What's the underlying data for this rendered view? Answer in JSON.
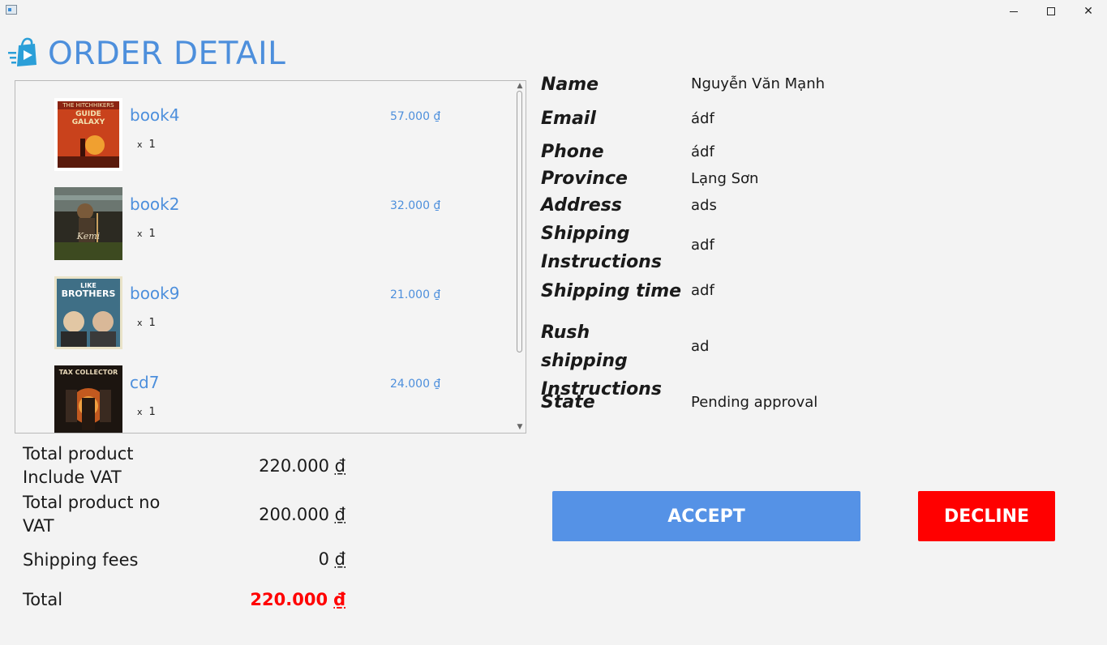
{
  "header": {
    "title": "ORDER DETAIL"
  },
  "items": [
    {
      "name": "book4",
      "price": "57.000 ₫",
      "qty_prefix": "x",
      "qty": "1",
      "cover_icon": "book-cover-galaxy"
    },
    {
      "name": "book2",
      "price": "32.000 ₫",
      "qty_prefix": "x",
      "qty": "1",
      "cover_icon": "book-cover-western"
    },
    {
      "name": "book9",
      "price": "21.000 ₫",
      "qty_prefix": "x",
      "qty": "1",
      "cover_icon": "book-cover-brothers"
    },
    {
      "name": "cd7",
      "price": "24.000 ₫",
      "qty_prefix": "x",
      "qty": "1",
      "cover_icon": "cd-cover-tax-collector"
    }
  ],
  "totals": {
    "incl_vat_label": "Total product Include VAT",
    "incl_vat_value": "220.000",
    "no_vat_label": "Total product no VAT",
    "no_vat_value": "200.000",
    "shipping_label": "Shipping fees",
    "shipping_value": "0",
    "total_label": "Total",
    "total_value": "220.000",
    "currency": "₫"
  },
  "customer": {
    "name_label": "Name",
    "name_value": "Nguyễn Văn Mạnh",
    "email_label": "Email",
    "email_value": "ádf",
    "phone_label": "Phone",
    "phone_value": "ádf",
    "province_label": "Province",
    "province_value": "Lạng Sơn",
    "address_label": "Address",
    "address_value": "ads",
    "shipping_instr_label": "Shipping Instructions",
    "shipping_instr_value": "adf",
    "shipping_time_label": "Shipping time",
    "shipping_time_value": "adf",
    "rush_label": "Rush shipping Instructions",
    "rush_value": "ad",
    "state_label": "State",
    "state_value": "Pending approval"
  },
  "actions": {
    "accept_label": "ACCEPT",
    "decline_label": "DECLINE"
  },
  "colors": {
    "accent": "#4d8fdc",
    "accept": "#5592e6",
    "decline": "#ff0000",
    "total": "#ff0000"
  }
}
